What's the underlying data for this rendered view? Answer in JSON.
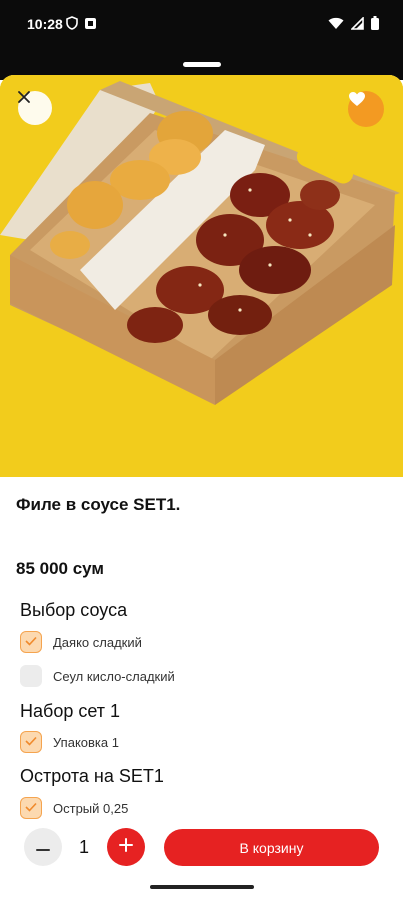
{
  "status_bar": {
    "time": "10:28",
    "icons_left": [
      "shield-icon",
      "notification-icon"
    ],
    "icons_right": [
      "wifi-icon",
      "signal-icon",
      "battery-icon"
    ]
  },
  "hero": {
    "image": "food-box-image",
    "close_icon": "close-icon",
    "favorite_icon": "heart-icon"
  },
  "product": {
    "title": "Филе в соусе SET1.",
    "price": "85 000 сум"
  },
  "sections": [
    {
      "title": "Выбор соуса",
      "options": [
        {
          "label": "Даяко сладкий",
          "checked": true
        },
        {
          "label": "Сеул кисло-сладкий",
          "checked": false
        }
      ]
    },
    {
      "title": "Набор сет 1",
      "options": [
        {
          "label": "Упаковка 1",
          "checked": true
        }
      ]
    },
    {
      "title": "Острота на SET1",
      "options": [
        {
          "label": "Острый  0,25",
          "checked": true
        }
      ]
    }
  ],
  "bottom_bar": {
    "minus_icon": "minus-icon",
    "quantity": "1",
    "plus_icon": "plus-icon",
    "add_to_cart_label": "В корзину"
  },
  "colors": {
    "accent": "#e62222",
    "checkbox_fill": "#fcd9b0",
    "checkbox_border": "#f5a44f",
    "favorite": "#f39a22",
    "hero_background": "#f2cc1c"
  }
}
